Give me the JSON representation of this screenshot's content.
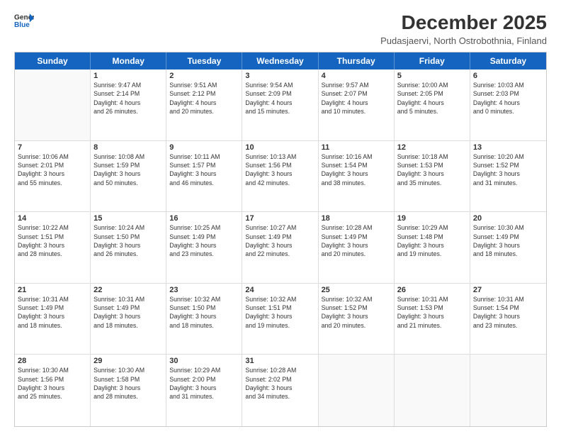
{
  "header": {
    "logo_line1": "General",
    "logo_line2": "Blue",
    "month_year": "December 2025",
    "location": "Pudasjaervi, North Ostrobothnia, Finland"
  },
  "weekdays": [
    "Sunday",
    "Monday",
    "Tuesday",
    "Wednesday",
    "Thursday",
    "Friday",
    "Saturday"
  ],
  "weeks": [
    [
      {
        "day": "",
        "info": ""
      },
      {
        "day": "1",
        "info": "Sunrise: 9:47 AM\nSunset: 2:14 PM\nDaylight: 4 hours\nand 26 minutes."
      },
      {
        "day": "2",
        "info": "Sunrise: 9:51 AM\nSunset: 2:12 PM\nDaylight: 4 hours\nand 20 minutes."
      },
      {
        "day": "3",
        "info": "Sunrise: 9:54 AM\nSunset: 2:09 PM\nDaylight: 4 hours\nand 15 minutes."
      },
      {
        "day": "4",
        "info": "Sunrise: 9:57 AM\nSunset: 2:07 PM\nDaylight: 4 hours\nand 10 minutes."
      },
      {
        "day": "5",
        "info": "Sunrise: 10:00 AM\nSunset: 2:05 PM\nDaylight: 4 hours\nand 5 minutes."
      },
      {
        "day": "6",
        "info": "Sunrise: 10:03 AM\nSunset: 2:03 PM\nDaylight: 4 hours\nand 0 minutes."
      }
    ],
    [
      {
        "day": "7",
        "info": "Sunrise: 10:06 AM\nSunset: 2:01 PM\nDaylight: 3 hours\nand 55 minutes."
      },
      {
        "day": "8",
        "info": "Sunrise: 10:08 AM\nSunset: 1:59 PM\nDaylight: 3 hours\nand 50 minutes."
      },
      {
        "day": "9",
        "info": "Sunrise: 10:11 AM\nSunset: 1:57 PM\nDaylight: 3 hours\nand 46 minutes."
      },
      {
        "day": "10",
        "info": "Sunrise: 10:13 AM\nSunset: 1:56 PM\nDaylight: 3 hours\nand 42 minutes."
      },
      {
        "day": "11",
        "info": "Sunrise: 10:16 AM\nSunset: 1:54 PM\nDaylight: 3 hours\nand 38 minutes."
      },
      {
        "day": "12",
        "info": "Sunrise: 10:18 AM\nSunset: 1:53 PM\nDaylight: 3 hours\nand 35 minutes."
      },
      {
        "day": "13",
        "info": "Sunrise: 10:20 AM\nSunset: 1:52 PM\nDaylight: 3 hours\nand 31 minutes."
      }
    ],
    [
      {
        "day": "14",
        "info": "Sunrise: 10:22 AM\nSunset: 1:51 PM\nDaylight: 3 hours\nand 28 minutes."
      },
      {
        "day": "15",
        "info": "Sunrise: 10:24 AM\nSunset: 1:50 PM\nDaylight: 3 hours\nand 26 minutes."
      },
      {
        "day": "16",
        "info": "Sunrise: 10:25 AM\nSunset: 1:49 PM\nDaylight: 3 hours\nand 23 minutes."
      },
      {
        "day": "17",
        "info": "Sunrise: 10:27 AM\nSunset: 1:49 PM\nDaylight: 3 hours\nand 22 minutes."
      },
      {
        "day": "18",
        "info": "Sunrise: 10:28 AM\nSunset: 1:49 PM\nDaylight: 3 hours\nand 20 minutes."
      },
      {
        "day": "19",
        "info": "Sunrise: 10:29 AM\nSunset: 1:48 PM\nDaylight: 3 hours\nand 19 minutes."
      },
      {
        "day": "20",
        "info": "Sunrise: 10:30 AM\nSunset: 1:49 PM\nDaylight: 3 hours\nand 18 minutes."
      }
    ],
    [
      {
        "day": "21",
        "info": "Sunrise: 10:31 AM\nSunset: 1:49 PM\nDaylight: 3 hours\nand 18 minutes."
      },
      {
        "day": "22",
        "info": "Sunrise: 10:31 AM\nSunset: 1:49 PM\nDaylight: 3 hours\nand 18 minutes."
      },
      {
        "day": "23",
        "info": "Sunrise: 10:32 AM\nSunset: 1:50 PM\nDaylight: 3 hours\nand 18 minutes."
      },
      {
        "day": "24",
        "info": "Sunrise: 10:32 AM\nSunset: 1:51 PM\nDaylight: 3 hours\nand 19 minutes."
      },
      {
        "day": "25",
        "info": "Sunrise: 10:32 AM\nSunset: 1:52 PM\nDaylight: 3 hours\nand 20 minutes."
      },
      {
        "day": "26",
        "info": "Sunrise: 10:31 AM\nSunset: 1:53 PM\nDaylight: 3 hours\nand 21 minutes."
      },
      {
        "day": "27",
        "info": "Sunrise: 10:31 AM\nSunset: 1:54 PM\nDaylight: 3 hours\nand 23 minutes."
      }
    ],
    [
      {
        "day": "28",
        "info": "Sunrise: 10:30 AM\nSunset: 1:56 PM\nDaylight: 3 hours\nand 25 minutes."
      },
      {
        "day": "29",
        "info": "Sunrise: 10:30 AM\nSunset: 1:58 PM\nDaylight: 3 hours\nand 28 minutes."
      },
      {
        "day": "30",
        "info": "Sunrise: 10:29 AM\nSunset: 2:00 PM\nDaylight: 3 hours\nand 31 minutes."
      },
      {
        "day": "31",
        "info": "Sunrise: 10:28 AM\nSunset: 2:02 PM\nDaylight: 3 hours\nand 34 minutes."
      },
      {
        "day": "",
        "info": ""
      },
      {
        "day": "",
        "info": ""
      },
      {
        "day": "",
        "info": ""
      }
    ]
  ]
}
